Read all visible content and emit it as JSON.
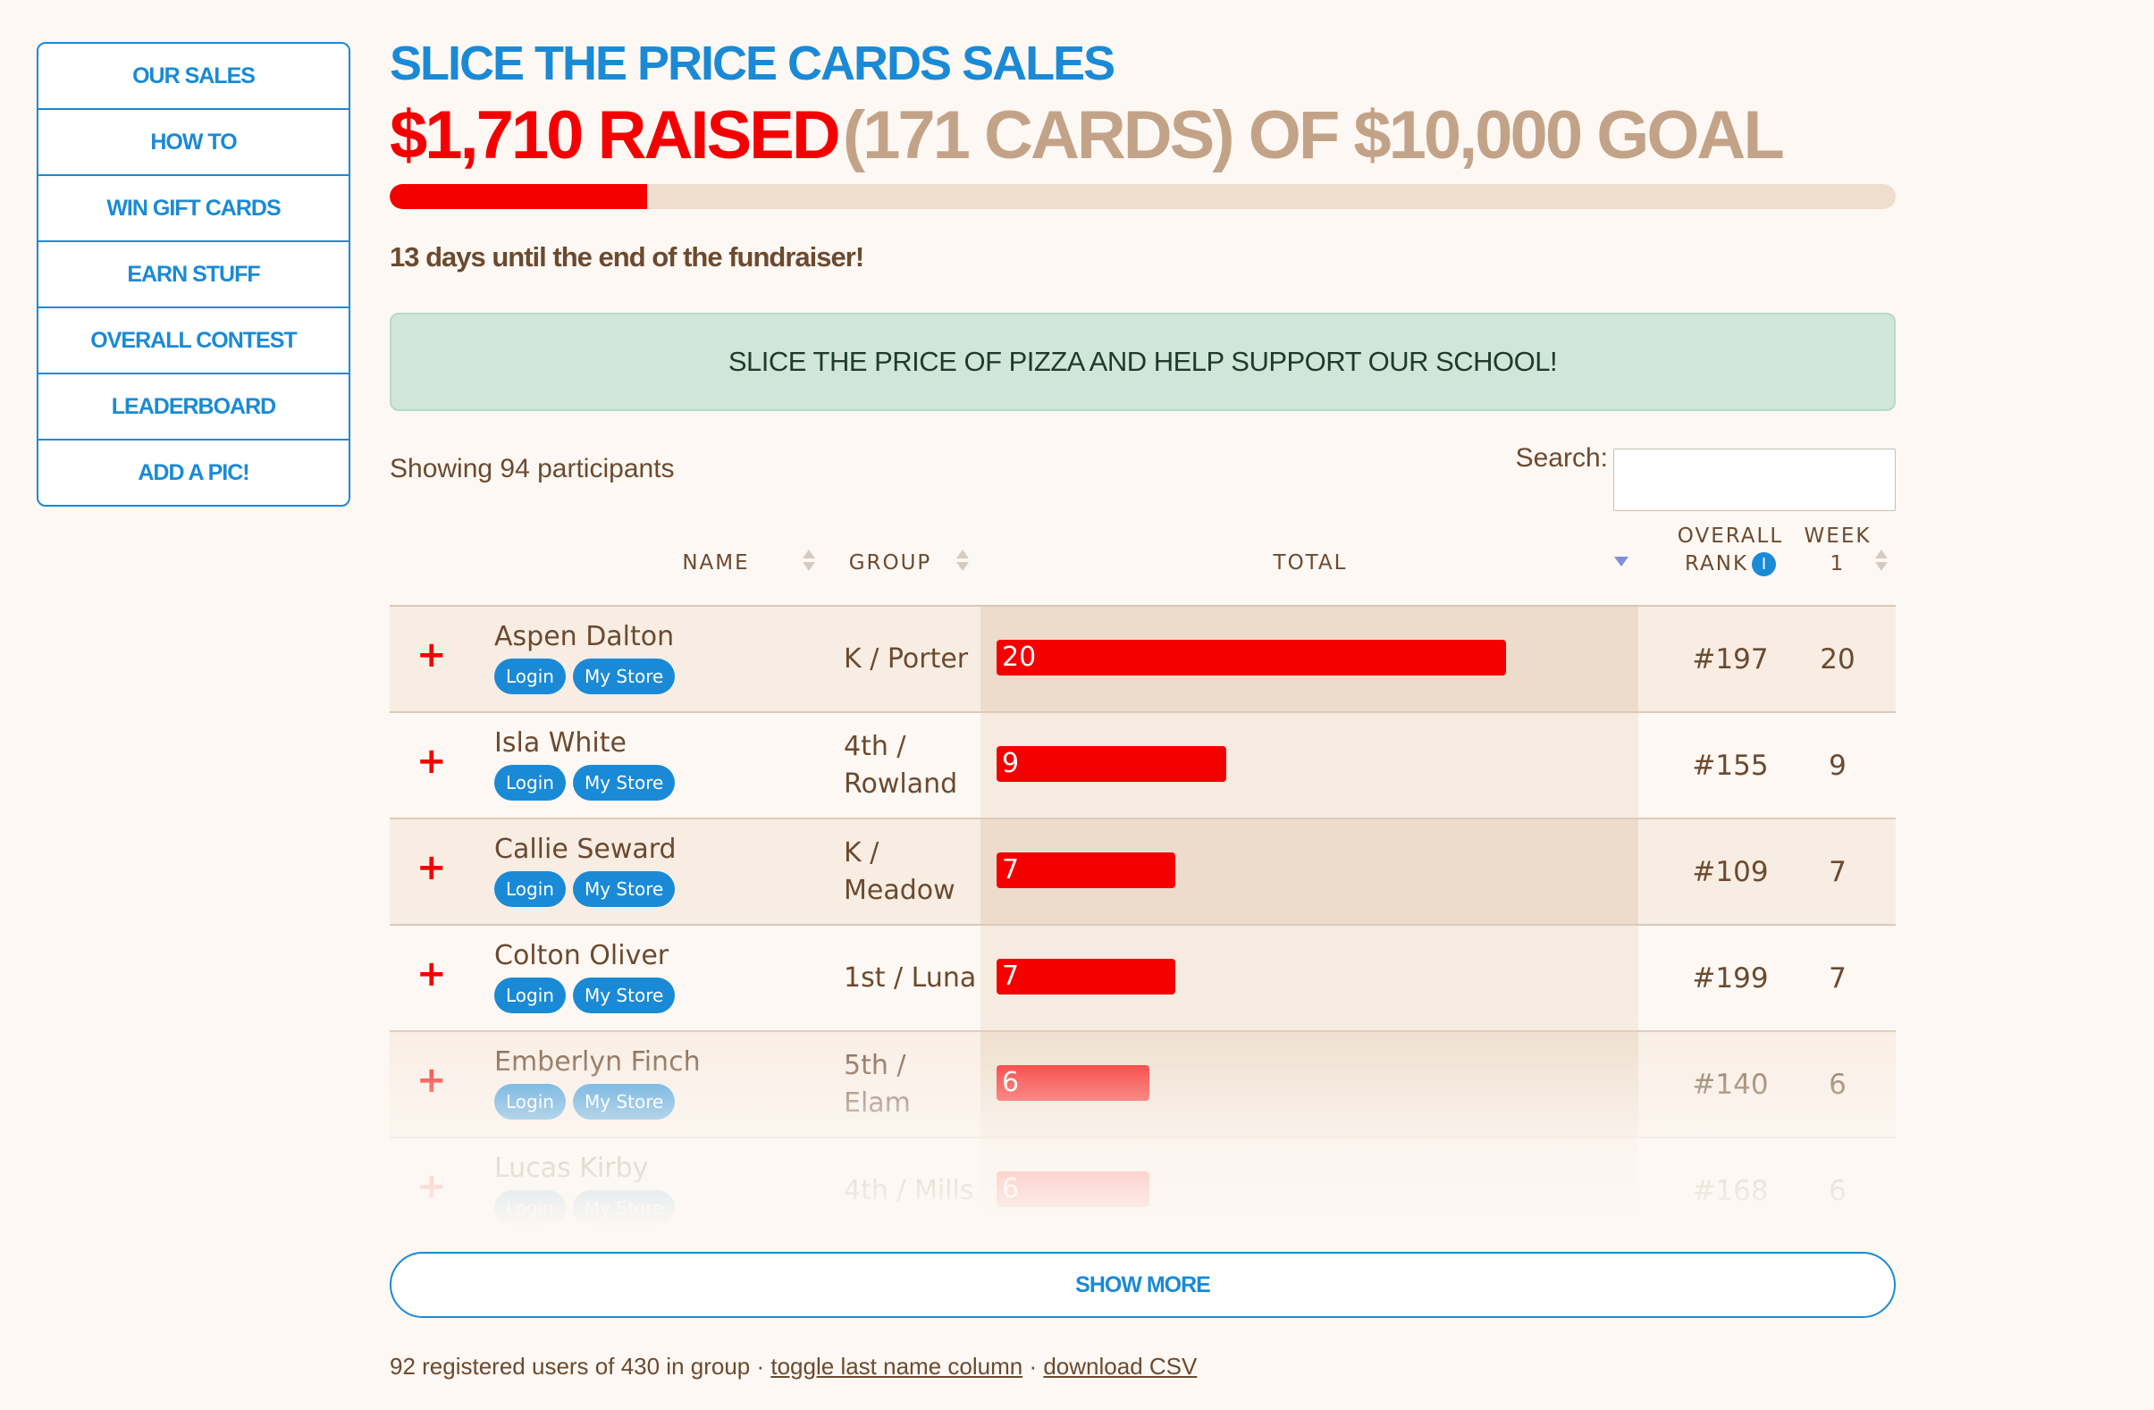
{
  "sidebar": {
    "items": [
      {
        "label": "OUR SALES"
      },
      {
        "label": "HOW TO"
      },
      {
        "label": "WIN GIFT CARDS"
      },
      {
        "label": "EARN STUFF"
      },
      {
        "label": "OVERALL CONTEST"
      },
      {
        "label": "LEADERBOARD"
      },
      {
        "label": "ADD A PIC!"
      }
    ]
  },
  "header": {
    "title": "SLICE THE PRICE CARDS SALES",
    "raised_amount": "$1,710 RAISED",
    "raised_rest": "(171 CARDS) OF $10,000 GOAL",
    "progress_fraction": 0.171,
    "days_left": "13 days until the end of the fundraiser!"
  },
  "banner": {
    "text": "SLICE THE PRICE OF PIZZA AND HELP SUPPORT OUR SCHOOL!"
  },
  "controls": {
    "showing": "Showing 94 participants",
    "search_label": "Search:",
    "search_value": ""
  },
  "table": {
    "headers": {
      "name": "NAME",
      "group": "GROUP",
      "total": "TOTAL",
      "overall_rank_line1": "OVERALL",
      "overall_rank_line2": "RANK",
      "info_icon": "i",
      "week_line1": "WEEK",
      "week_line2": "1"
    },
    "max_total": 20,
    "rows": [
      {
        "name": "Aspen Dalton",
        "group": "K / Porter",
        "total": "20",
        "total_value": 20,
        "rank": "#197",
        "week": "20",
        "login": "Login",
        "store": "My Store",
        "expand": "+"
      },
      {
        "name": "Isla White",
        "group": "4th / Rowland",
        "total": "9",
        "total_value": 9,
        "rank": "#155",
        "week": "9",
        "login": "Login",
        "store": "My Store",
        "expand": "+"
      },
      {
        "name": "Callie Seward",
        "group": "K / Meadow",
        "total": "7",
        "total_value": 7,
        "rank": "#109",
        "week": "7",
        "login": "Login",
        "store": "My Store",
        "expand": "+"
      },
      {
        "name": "Colton Oliver",
        "group": "1st / Luna",
        "total": "7",
        "total_value": 7,
        "rank": "#199",
        "week": "7",
        "login": "Login",
        "store": "My Store",
        "expand": "+"
      },
      {
        "name": "Emberlyn Finch",
        "group": "5th / Elam",
        "total": "6",
        "total_value": 6,
        "rank": "#140",
        "week": "6",
        "login": "Login",
        "store": "My Store",
        "expand": "+"
      },
      {
        "name": "Lucas Kirby",
        "group": "4th / Mills",
        "total": "6",
        "total_value": 6,
        "rank": "#168",
        "week": "6",
        "login": "Login",
        "store": "My Store",
        "expand": "+"
      }
    ]
  },
  "show_more": {
    "label": "SHOW MORE"
  },
  "footer": {
    "text": "92 registered users of 430 in group ·",
    "toggle_link": "toggle last name column",
    "separator": "·",
    "download_link": "download CSV"
  },
  "colors": {
    "accent_blue": "#1a8ad6",
    "accent_red": "#f40000",
    "text_brown": "#6b4a2f",
    "muted_tan": "#c3a388",
    "banner_green": "#d0e6db"
  }
}
